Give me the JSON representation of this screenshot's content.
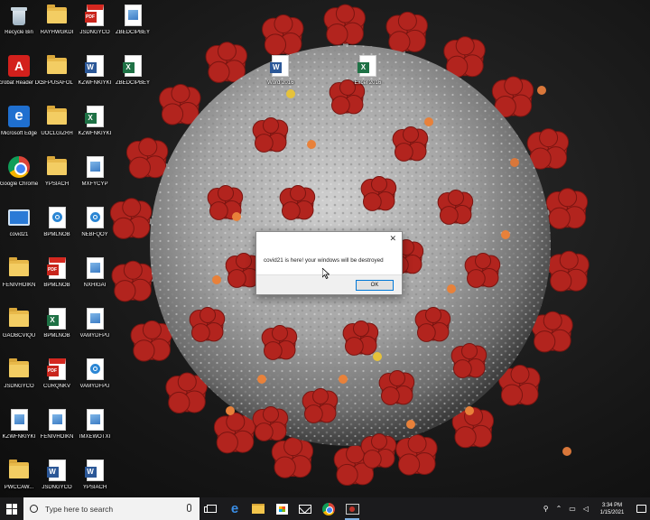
{
  "desktop": {
    "icons": [
      {
        "label": "Recycle Bin",
        "icon": "recycle-bin-icon"
      },
      {
        "label": "RAYHWGKDI",
        "icon": "folder-icon"
      },
      {
        "label": "JSDNGYCO",
        "icon": "pdf-file-icon"
      },
      {
        "label": "ZBEDCIPBEY",
        "icon": "image-file-icon"
      },
      {
        "label": "Acrobat Reader DC",
        "icon": "acrobat-icon"
      },
      {
        "label": "SFPUSAFOL",
        "icon": "folder-icon"
      },
      {
        "label": "KZWFNKIYKI",
        "icon": "word-file-icon"
      },
      {
        "label": "ZBEDCIPBEY",
        "icon": "excel-file-icon"
      },
      {
        "label": "Word 2016",
        "icon": "word-file-icon"
      },
      {
        "label": "Excel 2016",
        "icon": "excel-file-icon"
      },
      {
        "label": "Microsoft Edge",
        "icon": "edge-icon"
      },
      {
        "label": "UOCLGIZRH",
        "icon": "folder-icon"
      },
      {
        "label": "KZWFNKIYKI",
        "icon": "excel-file-icon"
      },
      {
        "label": "Google Chrome",
        "icon": "chrome-icon"
      },
      {
        "label": "YPSIACH",
        "icon": "folder-icon"
      },
      {
        "label": "MXFYCYP",
        "icon": "image-file-icon"
      },
      {
        "label": "covid21",
        "icon": "monitor-icon"
      },
      {
        "label": "BPMLNOB",
        "icon": "settings-file-icon"
      },
      {
        "label": "NEBFQOY",
        "icon": "settings-file-icon"
      },
      {
        "label": "FENIVHOIKN",
        "icon": "folder-icon"
      },
      {
        "label": "BPMLNOB",
        "icon": "pdf-file-icon"
      },
      {
        "label": "NXHIGAI",
        "icon": "image-file-icon"
      },
      {
        "label": "GAOBCVIQU",
        "icon": "folder-icon"
      },
      {
        "label": "BPMLNOB",
        "icon": "excel-file-icon"
      },
      {
        "label": "VAMYDFPU",
        "icon": "image-file-icon"
      },
      {
        "label": "JSDNGYCO",
        "icon": "folder-icon"
      },
      {
        "label": "CURQNKV",
        "icon": "pdf-file-icon"
      },
      {
        "label": "VAMYDFPU",
        "icon": "settings-file-icon"
      },
      {
        "label": "KZWFNKIYKI",
        "icon": "image-file-icon"
      },
      {
        "label": "FENIVHOIKN",
        "icon": "image-file-icon"
      },
      {
        "label": "IMXEWOTXI",
        "icon": "image-file-icon"
      },
      {
        "label": "PWCCAW...",
        "icon": "folder-icon"
      },
      {
        "label": "JSDNGYCO",
        "icon": "word-file-icon"
      },
      {
        "label": "YPSIACH",
        "icon": "word-file-icon"
      }
    ]
  },
  "dialog": {
    "message": "covid21 is here! your windows will be destroyed",
    "ok_label": "OK",
    "close_glyph": "✕"
  },
  "taskbar": {
    "search_placeholder": "Type here to search",
    "pinned": [
      "task-view-icon",
      "edge-icon",
      "file-explorer-icon",
      "store-icon",
      "mail-icon",
      "chrome-icon",
      "covid21-app-icon"
    ],
    "tray": {
      "time": "3:34 PM",
      "date": "1/15/2021"
    }
  },
  "colors": {
    "virus_red": "#b2241e",
    "virus_gray": "#a9a9a9",
    "taskbar_bg": "#1b1b1d",
    "dialog_accent": "#0078d7"
  }
}
